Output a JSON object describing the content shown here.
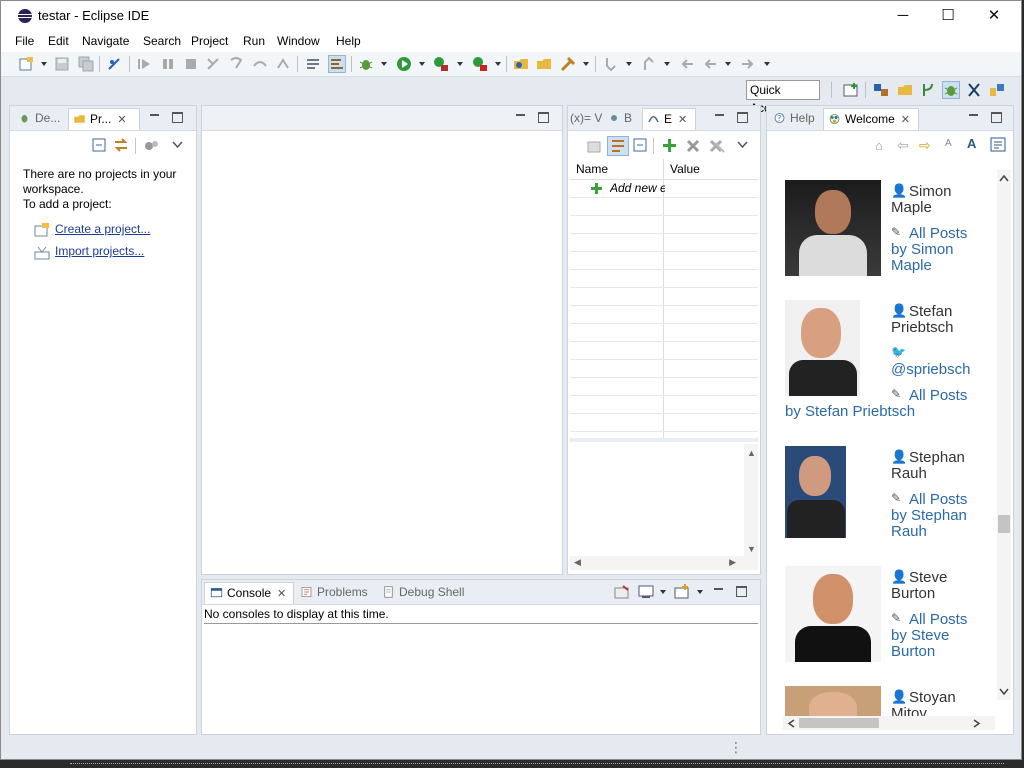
{
  "window": {
    "title": "testar - Eclipse IDE",
    "minimize": "─",
    "maximize": "☐",
    "close": "✕"
  },
  "menu": [
    "File",
    "Edit",
    "Navigate",
    "Search",
    "Project",
    "Run",
    "Window",
    "Help"
  ],
  "quick_access": "Quick Access",
  "left_panel": {
    "tabs": [
      {
        "label": "De..."
      },
      {
        "label": "Pr..."
      }
    ],
    "empty_line1": "There are no projects in your",
    "empty_line2": "workspace.",
    "empty_line3": "To add a project:",
    "create_link": "Create a project...",
    "import_link": "Import projects..."
  },
  "expr_panel": {
    "tabs": [
      {
        "label": "(x)= V"
      },
      {
        "label": "B"
      },
      {
        "label": "E"
      }
    ],
    "col_name": "Name",
    "col_value": "Value",
    "add_row": "Add new e"
  },
  "console_panel": {
    "tabs": [
      {
        "label": "Console"
      },
      {
        "label": "Problems"
      },
      {
        "label": "Debug Shell"
      }
    ],
    "message": "No consoles to display at this time."
  },
  "welcome_panel": {
    "tabs": [
      {
        "label": "Help"
      },
      {
        "label": "Welcome"
      }
    ],
    "authors": [
      {
        "name_line1": "Simon",
        "name_line2": "Maple",
        "posts_line1": "All Posts",
        "posts_line2": "by Simon",
        "posts_line3": "Maple"
      },
      {
        "name_line1": "Stefan",
        "name_line2": "Priebtsch",
        "twitter": "@spriebsch",
        "posts_line1": "All Posts",
        "posts_line2": "by Stefan Priebtsch"
      },
      {
        "name_line1": "Stephan",
        "name_line2": "Rauh",
        "posts_line1": "All Posts",
        "posts_line2": "by Stephan",
        "posts_line3": "Rauh"
      },
      {
        "name_line1": "Steve",
        "name_line2": "Burton",
        "posts_line1": "All Posts",
        "posts_line2": "by Steve",
        "posts_line3": "Burton"
      },
      {
        "name_line1": "Stoyan",
        "name_line2": "Mitov"
      }
    ]
  },
  "status_bar": {
    "grip": "⋮"
  },
  "colors": {
    "link": "#2b6aa8",
    "accent": "#1a3c9a",
    "frame": "#e4eaf0"
  }
}
